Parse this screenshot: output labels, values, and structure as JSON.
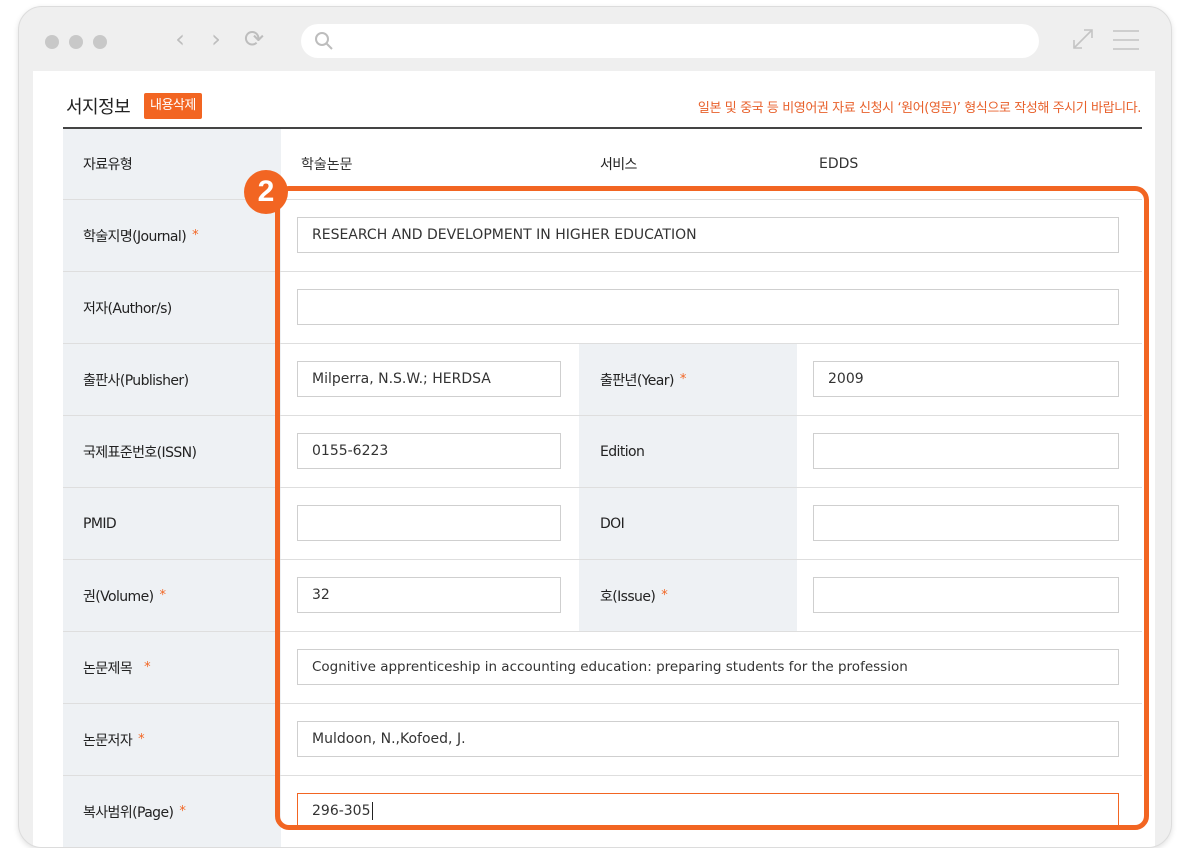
{
  "browser": {
    "icons": [
      "back-icon",
      "forward-icon",
      "reload-icon",
      "search-icon",
      "expand-icon",
      "menu-icon"
    ],
    "back_glyph": "‹",
    "forward_glyph": "›",
    "reload_glyph": "⟳",
    "address_value": ""
  },
  "section": {
    "title": "서지정보",
    "delete_label": "내용삭제",
    "notice": "일본 및 중국 등 비영어권 자료 신청시 ‘원어(영문)’ 형식으로 작성해 주시기 바랍니다."
  },
  "info_row": {
    "type_label": "자료유형",
    "type_value": "학술논문",
    "service_label": "서비스",
    "service_value": "EDDS"
  },
  "fields": {
    "journal": {
      "label": "학술지명(Journal)",
      "value": "RESEARCH AND DEVELOPMENT IN HIGHER EDUCATION"
    },
    "author": {
      "label": "저자(Author/s)",
      "value": ""
    },
    "publisher": {
      "label": "출판사(Publisher)",
      "value": "Milperra, N.S.W.; HERDSA"
    },
    "year": {
      "label": "출판년(Year)",
      "value": "2009"
    },
    "issn": {
      "label": "국제표준번호(ISSN)",
      "value": "0155-6223"
    },
    "edition": {
      "label": "Edition",
      "value": ""
    },
    "pmid": {
      "label": "PMID",
      "value": ""
    },
    "doi": {
      "label": "DOI",
      "value": ""
    },
    "volume": {
      "label": "권(Volume)",
      "value": "32"
    },
    "issue": {
      "label": "호(Issue)",
      "value": ""
    },
    "title": {
      "label": "논문제목",
      "value": "Cognitive apprenticeship in accounting education: preparing students for the profession"
    },
    "paper_author": {
      "label": "논문저자",
      "value": "Muldoon, N.,Kofoed, J."
    },
    "page": {
      "label": "복사범위(Page)",
      "value": "296-305"
    }
  },
  "required_mark": "*",
  "step_badge": "2",
  "colors": {
    "accent": "#f26522",
    "label_bg": "#eef1f4",
    "chrome": "#efefef"
  }
}
